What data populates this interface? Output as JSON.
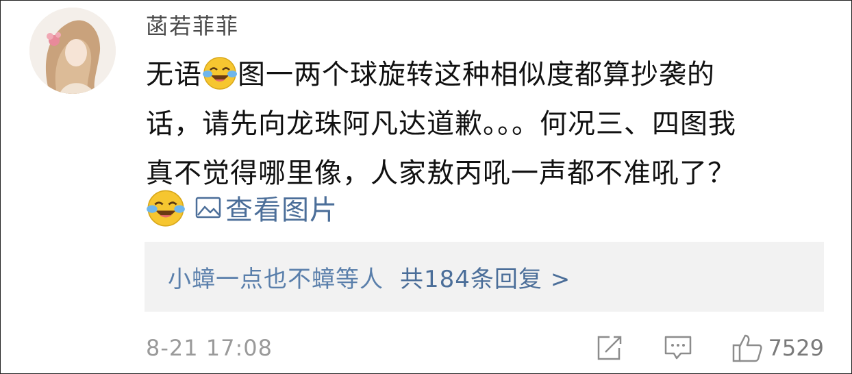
{
  "comment": {
    "username": "菡若菲菲",
    "lines": [
      {
        "before": "无语",
        "after": "图一两个球旋转这种相似度都算抄袭的"
      },
      {
        "text": "话，请先向龙珠阿凡达道歉。。。何况三、四图我"
      },
      {
        "text": "真不觉得哪里像，人家敖丙吼一声都不准吼了？"
      }
    ],
    "emoji_name": "laughing-crying-emoji",
    "view_images_label": "查看图片",
    "replies": {
      "names": "小蟑一点也不蟑",
      "others_suffix": "等人",
      "count_label": "共184条回复 >"
    },
    "timestamp": "8-21 17:08",
    "like_count": "7529"
  },
  "icons": {
    "image": "image-icon",
    "share": "share-edit-icon",
    "reply": "comment-icon",
    "like": "thumbs-up-icon"
  },
  "colors": {
    "link": "#4b6e99",
    "reply_box_bg": "#f2f2f2",
    "meta_gray": "#9a9a9a",
    "emoji_yellow": "#f6c630"
  }
}
